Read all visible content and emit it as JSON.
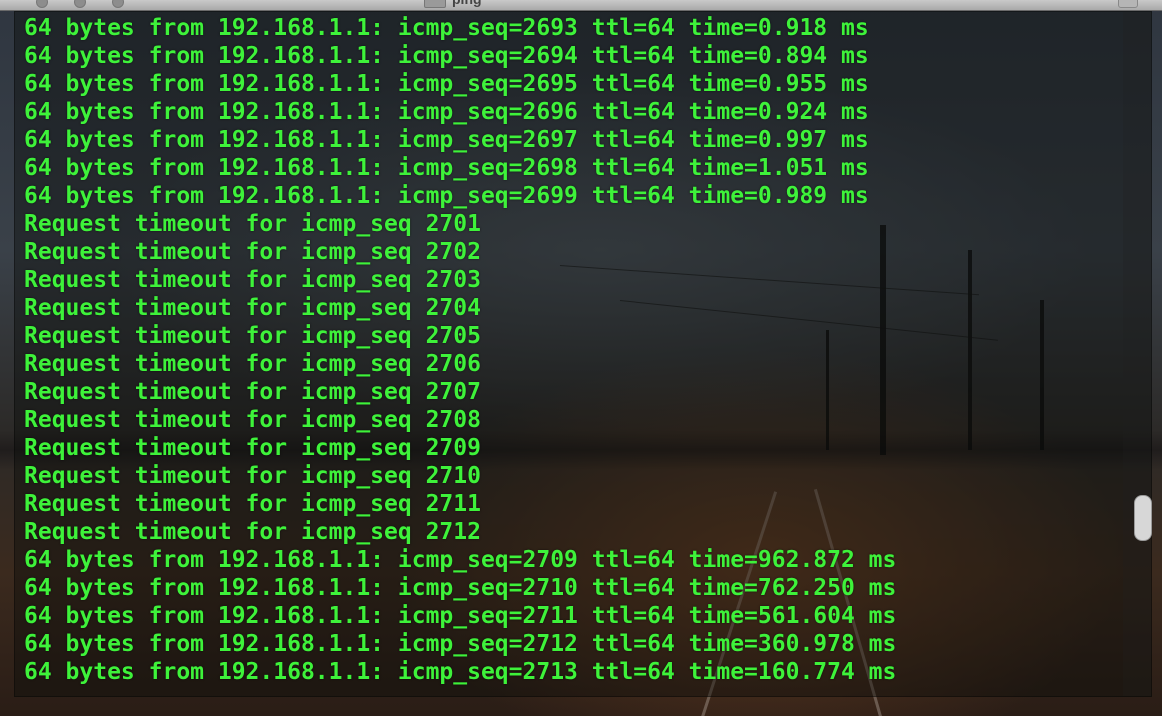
{
  "window": {
    "title": "ping"
  },
  "terminal": {
    "text_color": "#3ef23a",
    "lines": [
      "64 bytes from 192.168.1.1: icmp_seq=2693 ttl=64 time=0.918 ms",
      "64 bytes from 192.168.1.1: icmp_seq=2694 ttl=64 time=0.894 ms",
      "64 bytes from 192.168.1.1: icmp_seq=2695 ttl=64 time=0.955 ms",
      "64 bytes from 192.168.1.1: icmp_seq=2696 ttl=64 time=0.924 ms",
      "64 bytes from 192.168.1.1: icmp_seq=2697 ttl=64 time=0.997 ms",
      "64 bytes from 192.168.1.1: icmp_seq=2698 ttl=64 time=1.051 ms",
      "64 bytes from 192.168.1.1: icmp_seq=2699 ttl=64 time=0.989 ms",
      "Request timeout for icmp_seq 2701",
      "Request timeout for icmp_seq 2702",
      "Request timeout for icmp_seq 2703",
      "Request timeout for icmp_seq 2704",
      "Request timeout for icmp_seq 2705",
      "Request timeout for icmp_seq 2706",
      "Request timeout for icmp_seq 2707",
      "Request timeout for icmp_seq 2708",
      "Request timeout for icmp_seq 2709",
      "Request timeout for icmp_seq 2710",
      "Request timeout for icmp_seq 2711",
      "Request timeout for icmp_seq 2712",
      "64 bytes from 192.168.1.1: icmp_seq=2709 ttl=64 time=962.872 ms",
      "64 bytes from 192.168.1.1: icmp_seq=2710 ttl=64 time=762.250 ms",
      "64 bytes from 192.168.1.1: icmp_seq=2711 ttl=64 time=561.604 ms",
      "64 bytes from 192.168.1.1: icmp_seq=2712 ttl=64 time=360.978 ms",
      "64 bytes from 192.168.1.1: icmp_seq=2713 ttl=64 time=160.774 ms"
    ]
  },
  "scrollbar": {
    "position_fraction": 0.74
  }
}
